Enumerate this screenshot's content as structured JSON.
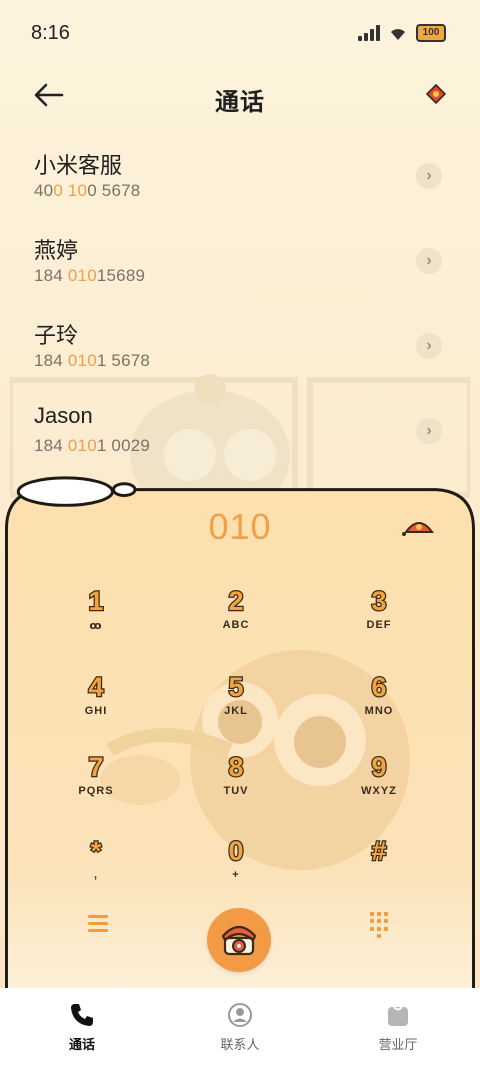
{
  "status": {
    "time": "8:16",
    "battery": "100"
  },
  "header": {
    "title": "通话"
  },
  "calls": [
    {
      "name": "小米客服",
      "num_parts": [
        "40",
        "0",
        " ",
        "10",
        "0 5678"
      ]
    },
    {
      "name": "燕婷",
      "num_parts": [
        "184 ",
        "010",
        "15689",
        "",
        ""
      ]
    },
    {
      "name": "子玲",
      "num_parts": [
        "184 ",
        "010",
        "1 5678",
        "",
        ""
      ]
    },
    {
      "name": "Jason",
      "num_parts": [
        "184 ",
        "010",
        "1 0029",
        "",
        ""
      ]
    }
  ],
  "dialer": {
    "input": "010"
  },
  "keys": [
    {
      "d": "1",
      "l": "ꝏ"
    },
    {
      "d": "2",
      "l": "ABC"
    },
    {
      "d": "3",
      "l": "DEF"
    },
    {
      "d": "4",
      "l": "GHI"
    },
    {
      "d": "5",
      "l": "JKL"
    },
    {
      "d": "6",
      "l": "MNO"
    },
    {
      "d": "7",
      "l": "PQRS"
    },
    {
      "d": "8",
      "l": "TUV"
    },
    {
      "d": "9",
      "l": "WXYZ"
    },
    {
      "d": "*",
      "l": ","
    },
    {
      "d": "0",
      "l": "+"
    },
    {
      "d": "#",
      "l": ""
    }
  ],
  "nav": {
    "calls": "通话",
    "contacts": "联系人",
    "hall": "营业厅"
  },
  "colors": {
    "accent": "#f0a04a",
    "panel_outline": "#1f1a14"
  },
  "icons": {
    "back": "arrow-left-icon",
    "badge": "red-envelope-icon",
    "call": "rotary-phone-icon"
  }
}
